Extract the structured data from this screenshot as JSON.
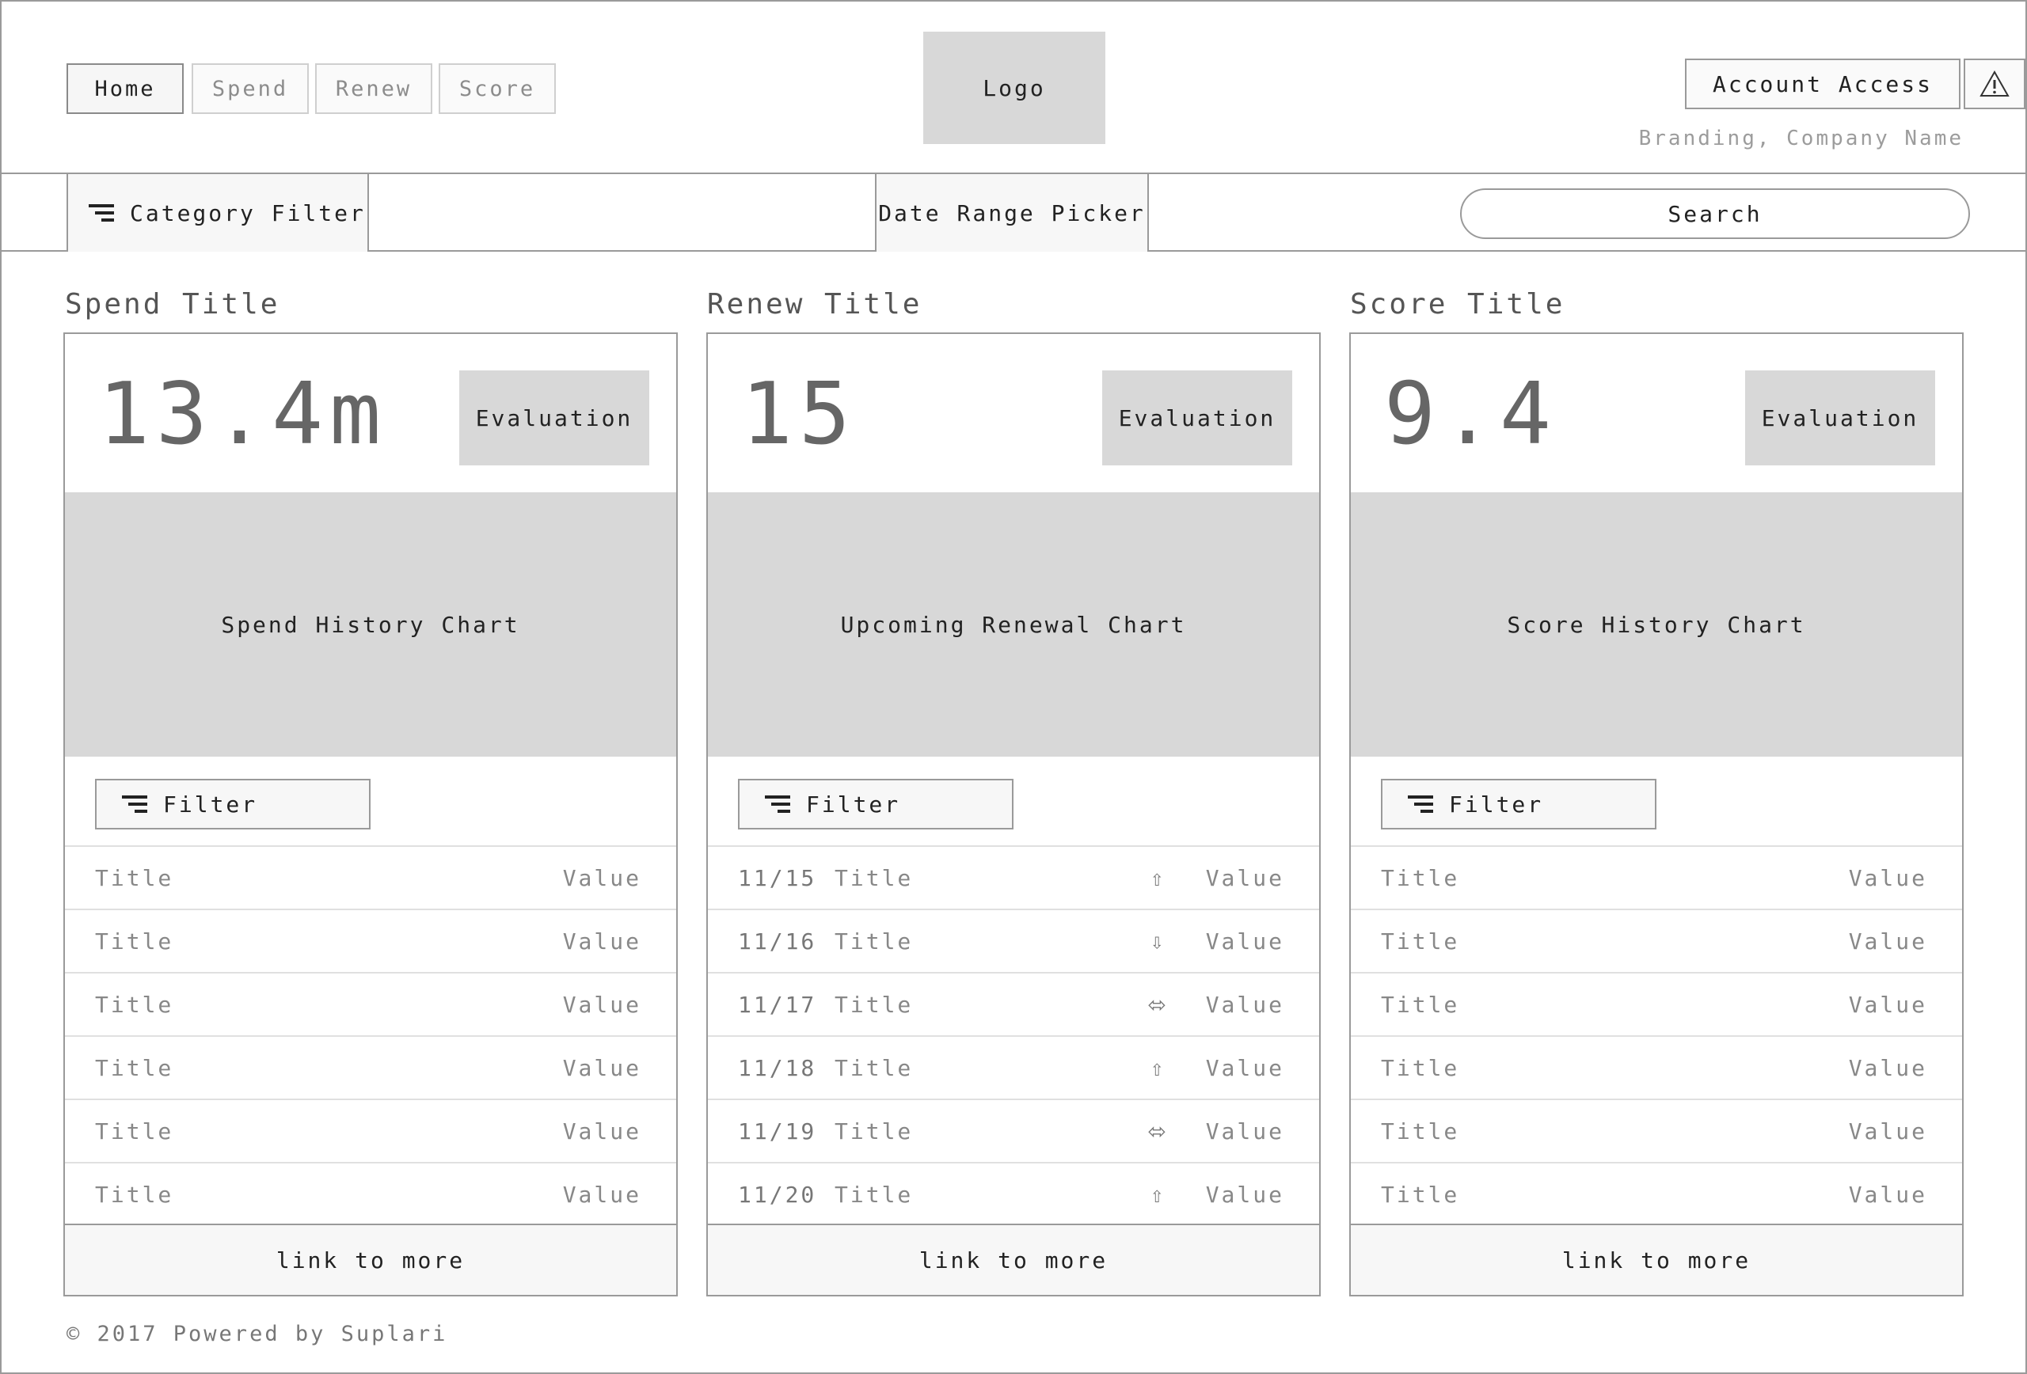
{
  "nav": {
    "tabs": [
      {
        "label": "Home",
        "active": true
      },
      {
        "label": "Spend",
        "active": false
      },
      {
        "label": "Renew",
        "active": false
      },
      {
        "label": "Score",
        "active": false
      }
    ]
  },
  "logo": "Logo",
  "account": {
    "label": "Account Access",
    "alert_icon": "warning-icon"
  },
  "branding": "Branding, Company Name",
  "toolbar": {
    "category_filter": "Category Filter",
    "date_range": "Date Range Picker",
    "search": "Search"
  },
  "panels": [
    {
      "title": "Spend Title",
      "metric": "13.4m",
      "evaluation": "Evaluation",
      "chart": "Spend History Chart",
      "filter": "Filter",
      "rows": [
        {
          "title": "Title",
          "value": "Value"
        },
        {
          "title": "Title",
          "value": "Value"
        },
        {
          "title": "Title",
          "value": "Value"
        },
        {
          "title": "Title",
          "value": "Value"
        },
        {
          "title": "Title",
          "value": "Value"
        },
        {
          "title": "Title",
          "value": "Value"
        }
      ],
      "more": "link to more"
    },
    {
      "title": "Renew Title",
      "metric": "15",
      "evaluation": "Evaluation",
      "chart": "Upcoming Renewal Chart",
      "filter": "Filter",
      "rows": [
        {
          "date": "11/15",
          "title": "Title",
          "trend": "⇧",
          "value": "Value"
        },
        {
          "date": "11/16",
          "title": "Title",
          "trend": "⇩",
          "value": "Value"
        },
        {
          "date": "11/17",
          "title": "Title",
          "trend": "⬄",
          "value": "Value"
        },
        {
          "date": "11/18",
          "title": "Title",
          "trend": "⇧",
          "value": "Value"
        },
        {
          "date": "11/19",
          "title": "Title",
          "trend": "⬄",
          "value": "Value"
        },
        {
          "date": "11/20",
          "title": "Title",
          "trend": "⇧",
          "value": "Value"
        }
      ],
      "more": "link to more"
    },
    {
      "title": "Score Title",
      "metric": "9.4",
      "evaluation": "Evaluation",
      "chart": "Score History Chart",
      "filter": "Filter",
      "rows": [
        {
          "title": "Title",
          "value": "Value"
        },
        {
          "title": "Title",
          "value": "Value"
        },
        {
          "title": "Title",
          "value": "Value"
        },
        {
          "title": "Title",
          "value": "Value"
        },
        {
          "title": "Title",
          "value": "Value"
        },
        {
          "title": "Title",
          "value": "Value"
        }
      ],
      "more": "link to more"
    }
  ],
  "footer": "© 2017 Powered by Suplari"
}
